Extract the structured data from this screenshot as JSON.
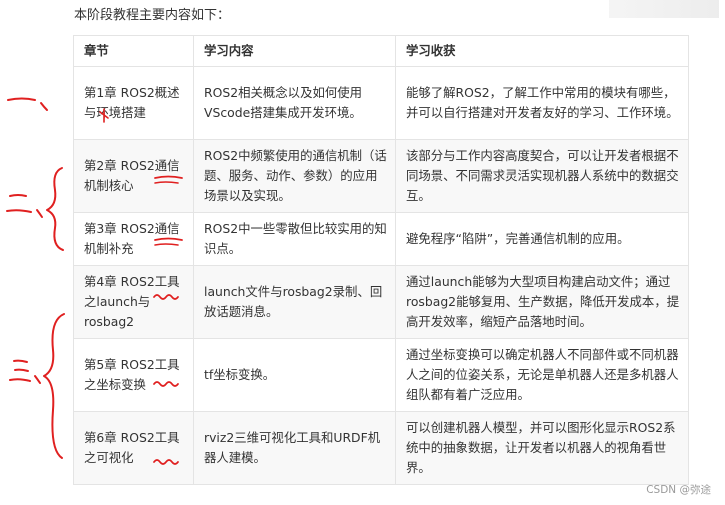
{
  "intro": "本阶段教程主要内容如下：",
  "table": {
    "headers": [
      "章节",
      "学习内容",
      "学习收获"
    ],
    "rows": [
      {
        "chapter": "第1章 ROS2概述与环境搭建",
        "content": "ROS2相关概念以及如何使用VScode搭建集成开发环境。",
        "gain": "能够了解ROS2，了解工作中常用的模块有哪些，并可以自行搭建对开发者友好的学习、工作环境。"
      },
      {
        "chapter": "第2章 ROS2通信机制核心",
        "content": "ROS2中频繁使用的通信机制（话题、服务、动作、参数）的应用场景以及实现。",
        "gain": "该部分与工作内容高度契合，可以让开发者根据不同场景、不同需求灵活实现机器人系统中的数据交互。"
      },
      {
        "chapter": "第3章 ROS2通信机制补充",
        "content": "ROS2中一些零散但比较实用的知识点。",
        "gain": "避免程序“陷阱”，完善通信机制的应用。"
      },
      {
        "chapter": "第4章 ROS2工具之launch与rosbag2",
        "content": "launch文件与rosbag2录制、回放话题消息。",
        "gain": "通过launch能够为大型项目构建启动文件；通过rosbag2能够复用、生产数据，降低开发成本，提高开发效率，缩短产品落地时间。"
      },
      {
        "chapter": "第5章 ROS2工具之坐标变换",
        "content": "tf坐标变换。",
        "gain": "通过坐标变换可以确定机器人不同部件或不同机器人之间的位姿关系，无论是单机器人还是多机器人组队都有着广泛应用。"
      },
      {
        "chapter": "第6章 ROS2工具之可视化",
        "content": "rviz2三维可视化工具和URDF机器人建模。",
        "gain": "可以创建机器人模型，并可以图形化显示ROS2系统中的抽象数据，让开发者以机器人的视角看世界。"
      }
    ]
  },
  "annotations": {
    "mark_1": "一、",
    "mark_2": "二、",
    "mark_3": "三、",
    "ink_color": "#e02020"
  },
  "watermark": "CSDN @弥途"
}
